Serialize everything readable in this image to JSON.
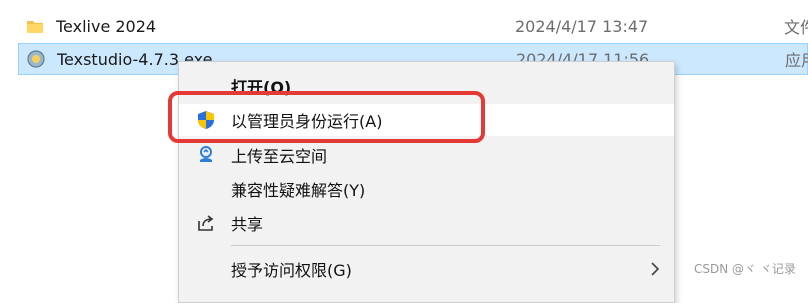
{
  "files": [
    {
      "name": "Texlive 2024",
      "date": "2024/4/17 13:47",
      "type": "文件",
      "icon": "folder-icon"
    },
    {
      "name": "Texstudio-4.7.3.exe",
      "date": "2024/4/17 11:56",
      "type": "应用",
      "icon": "texstudio-app-icon"
    }
  ],
  "context_menu": {
    "items": [
      {
        "label": "打开(O)",
        "icon": ""
      },
      {
        "label": "以管理员身份运行(A)",
        "icon": "uac-shield-icon"
      },
      {
        "label": "上传至云空间",
        "icon": "cloud-upload-icon"
      },
      {
        "label": "兼容性疑难解答(Y)",
        "icon": ""
      },
      {
        "label": "共享",
        "icon": "share-icon"
      },
      {
        "label": "授予访问权限(G)",
        "icon": "chevron-right-icon"
      }
    ]
  },
  "watermark": "CSDN @ヾ ヾ记录",
  "colors": {
    "highlight": "#e53935",
    "selection": "#cce8ff",
    "menu_bg": "#f2f2f2"
  }
}
